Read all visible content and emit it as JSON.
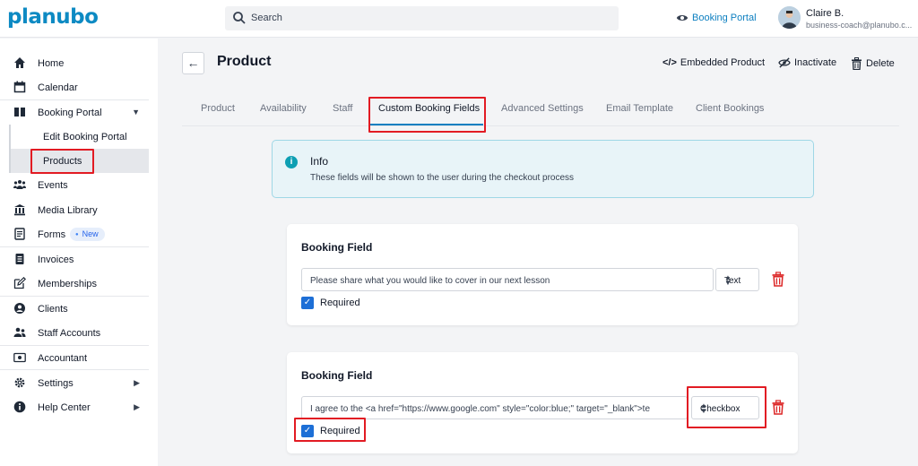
{
  "app": {
    "logo_text": "planubo",
    "search_placeholder": "Search",
    "booking_portal_link": "Booking Portal",
    "user_name": "Claire B.",
    "user_email": "business-coach@planubo.c..."
  },
  "sidebar": {
    "items": [
      {
        "label": "Home",
        "icon": "home-icon"
      },
      {
        "label": "Calendar",
        "icon": "calendar-icon"
      },
      {
        "label": "Booking Portal",
        "icon": "book-icon",
        "arrow": "▼"
      },
      {
        "label": "Edit Booking Portal"
      },
      {
        "label": "Products"
      },
      {
        "label": "Events",
        "icon": "group-icon"
      },
      {
        "label": "Media Library",
        "icon": "library-icon"
      },
      {
        "label": "Forms",
        "icon": "forms-icon",
        "badge": "New"
      },
      {
        "label": "Invoices",
        "icon": "invoice-icon"
      },
      {
        "label": "Memberships",
        "icon": "edit-icon"
      },
      {
        "label": "Clients",
        "icon": "user-circle-icon"
      },
      {
        "label": "Staff Accounts",
        "icon": "users-icon"
      },
      {
        "label": "Accountant",
        "icon": "cash-icon"
      },
      {
        "label": "Settings",
        "icon": "gear-icon",
        "arrow": "▶"
      },
      {
        "label": "Help Center",
        "icon": "info-icon",
        "arrow": "▶"
      }
    ]
  },
  "header": {
    "title": "Product",
    "back_symbol": "←",
    "actions": {
      "embedded": "Embedded Product",
      "inactivate": "Inactivate",
      "delete": "Delete"
    }
  },
  "tabs": [
    "Product",
    "Availability",
    "Staff",
    "Custom Booking Fields",
    "Advanced Settings",
    "Email Template",
    "Client Bookings"
  ],
  "active_tab": "Custom Booking Fields",
  "info": {
    "title": "Info",
    "text": "These fields will be shown to the user during the checkout process"
  },
  "booking_fields": [
    {
      "title": "Booking Field",
      "value": "Please share what you would like to cover in our next lesson",
      "type": "Text",
      "required_label": "Required",
      "required": true
    },
    {
      "title": "Booking Field",
      "value": "I agree to the <a href=\"https://www.google.com\" style=\"color:blue;\" target=\"_blank\">te",
      "type": "Checkbox",
      "required_label": "Required",
      "required": true
    }
  ],
  "colors": {
    "brand": "#0d8ac3",
    "highlight": "#e21b23",
    "checkbox": "#1d6fd6",
    "delete_icon": "#dc2626"
  }
}
